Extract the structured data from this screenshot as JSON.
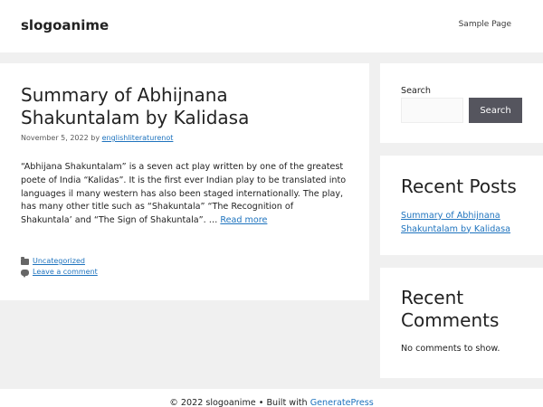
{
  "header": {
    "site_title": "slogoanime",
    "nav": {
      "sample_page": "Sample Page"
    }
  },
  "post": {
    "title": "Summary of Abhijnana Shakuntalam by Kalidasa",
    "date": "November 5, 2022",
    "by": "by",
    "author": "englishliteraturenot",
    "excerpt": "“Abhijana Shakuntalam” is a seven act play written by one of the greatest poete of India “Kalidas”. It is the first ever Indian play to be translated into languages il many western has also been staged internationally. The play, has many other title such as “Shakuntala” “The Recognition of Shakuntala’ and “The Sign of Shakuntala”. …",
    "read_more": "Read more",
    "category": "Uncategorized",
    "comment_link": "Leave a comment"
  },
  "sidebar": {
    "search": {
      "label": "Search",
      "button": "Search",
      "value": "",
      "placeholder": ""
    },
    "recent_posts": {
      "title": "Recent Posts",
      "items": [
        "Summary of Abhijnana Shakuntalam by Kalidasa"
      ]
    },
    "recent_comments": {
      "title": "Recent Comments",
      "empty": "No comments to show."
    }
  },
  "footer": {
    "copyright": "© 2022 slogoanime • Built with",
    "builder": "GeneratePress"
  },
  "colors": {
    "link": "#1e73be",
    "button": "#55555e",
    "background": "#f0f0f0"
  }
}
